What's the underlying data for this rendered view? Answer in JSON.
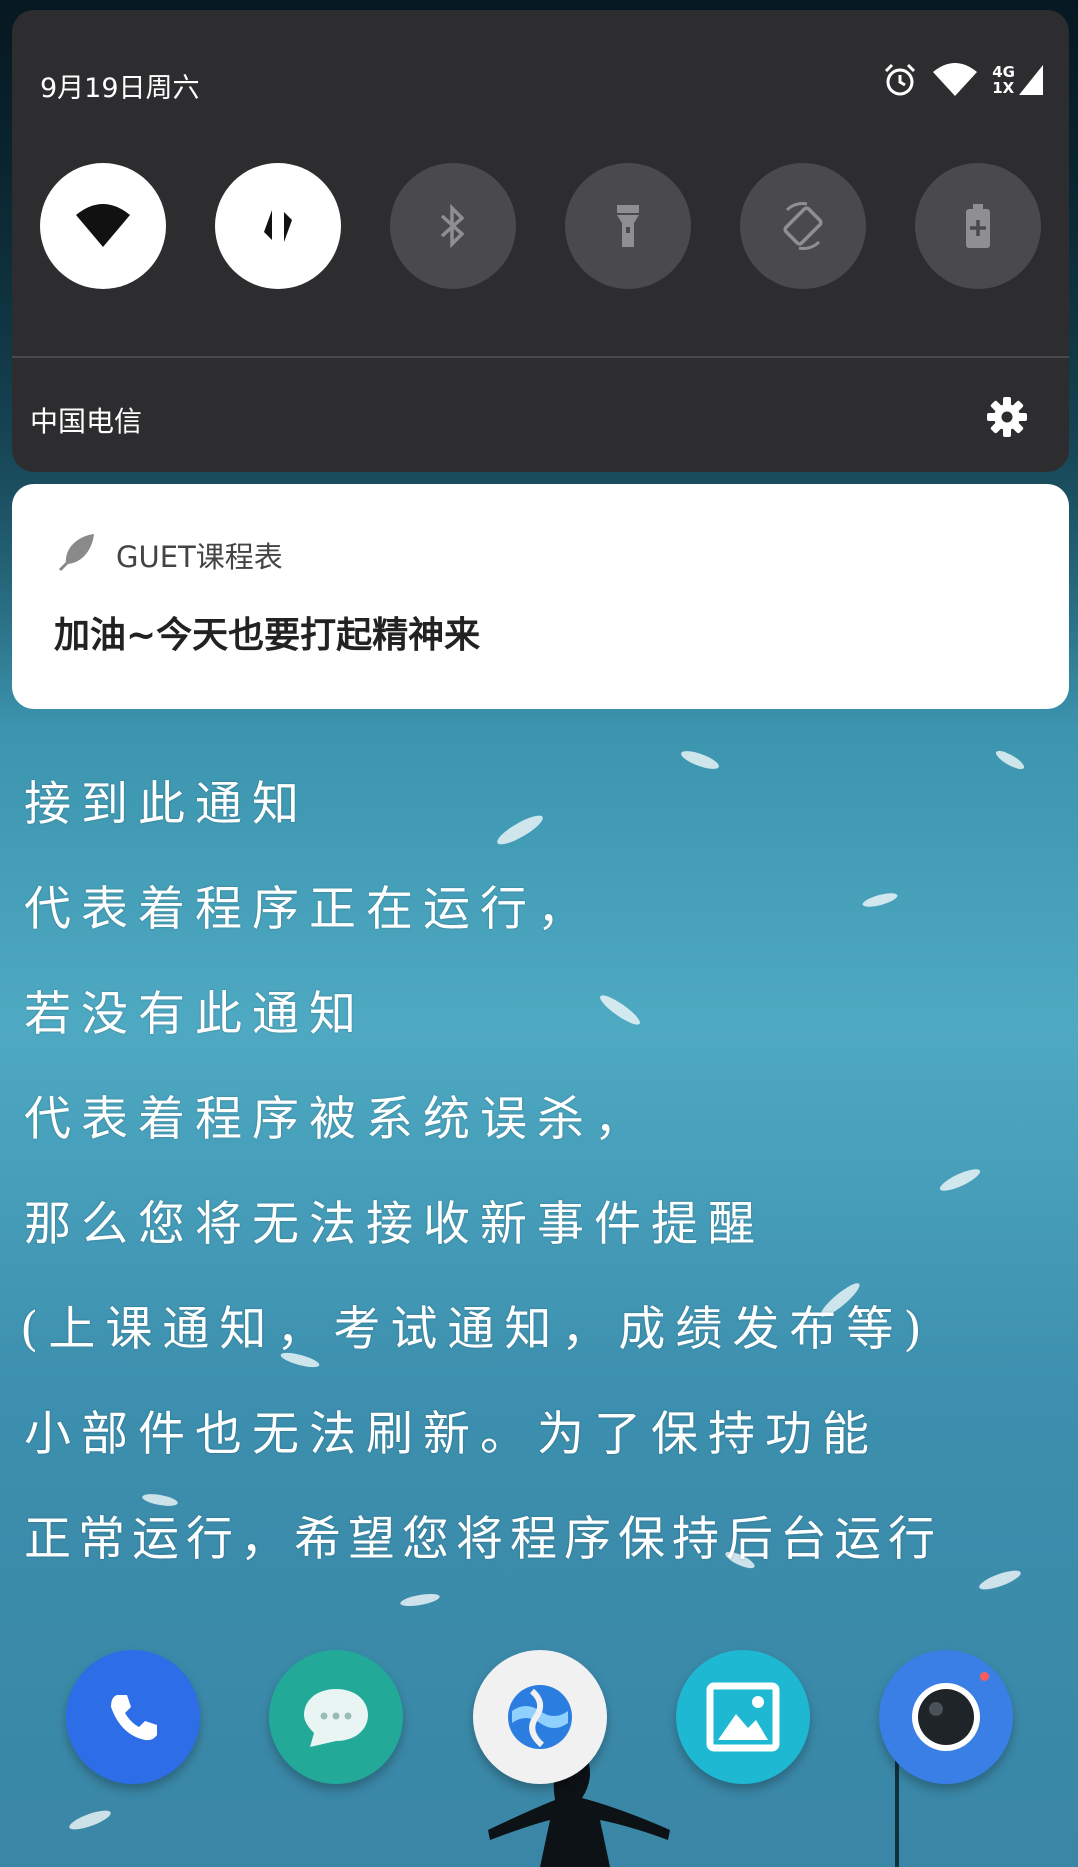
{
  "status_bar": {
    "date": "9月19日周六",
    "network_label_top": "4G",
    "network_label_bottom": "1X"
  },
  "quick_settings": {
    "tiles": [
      {
        "name": "wifi",
        "state": "on"
      },
      {
        "name": "mobile-data",
        "state": "on"
      },
      {
        "name": "bluetooth",
        "state": "off"
      },
      {
        "name": "flashlight",
        "state": "off"
      },
      {
        "name": "auto-rotate",
        "state": "off"
      },
      {
        "name": "battery-saver",
        "state": "off"
      }
    ],
    "carrier": "中国电信"
  },
  "notification": {
    "app_name": "GUET课程表",
    "message": "加油~今天也要打起精神来"
  },
  "wallpaper_text": {
    "lines": [
      "接到此通知",
      "代表着程序正在运行，",
      "若没有此通知",
      "代表着程序被系统误杀，",
      "那么您将无法接收新事件提醒",
      "(上课通知，考试通知，成绩发布等)",
      "小部件也无法刷新。为了保持功能",
      "正常运行，希望您将程序保持后台运行"
    ]
  },
  "dock": {
    "apps": [
      "phone",
      "messages",
      "browser",
      "gallery",
      "camera"
    ]
  },
  "colors": {
    "panel_bg": "#2d2d2f",
    "tile_off": "#4a4a4c",
    "tile_on": "#ffffff",
    "phone_blue": "#2d6ee8",
    "messages_teal": "#22a998",
    "gallery_cyan": "#1eb8d2",
    "camera_blue": "#3a7fe6"
  }
}
